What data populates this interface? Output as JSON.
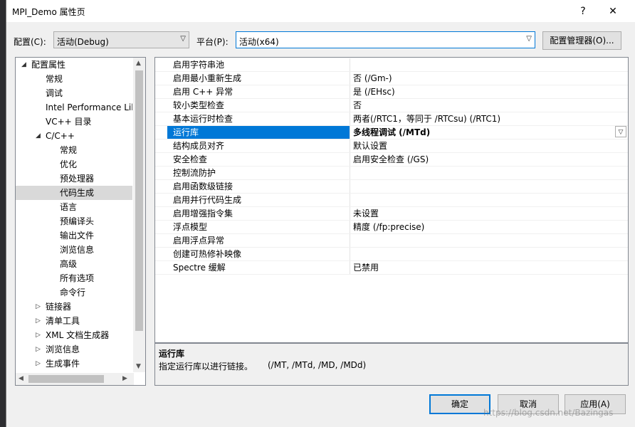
{
  "window": {
    "title": "MPI_Demo 属性页",
    "help_label": "?",
    "close_label": "✕"
  },
  "config": {
    "config_label": "配置(C):",
    "config_value": "活动(Debug)",
    "platform_label": "平台(P):",
    "platform_value": "活动(x64)",
    "manager_label": "配置管理器(O)..."
  },
  "tree": {
    "items": [
      {
        "label": "配置属性",
        "toggle": "◢"
      },
      {
        "label": "常规",
        "toggle": ""
      },
      {
        "label": "调试",
        "toggle": ""
      },
      {
        "label": "Intel Performance Libraries",
        "toggle": ""
      },
      {
        "label": "VC++ 目录",
        "toggle": ""
      },
      {
        "label": "C/C++",
        "toggle": "◢"
      },
      {
        "label": "常规",
        "toggle": ""
      },
      {
        "label": "优化",
        "toggle": ""
      },
      {
        "label": "预处理器",
        "toggle": ""
      },
      {
        "label": "代码生成",
        "toggle": ""
      },
      {
        "label": "语言",
        "toggle": ""
      },
      {
        "label": "预编译头",
        "toggle": ""
      },
      {
        "label": "输出文件",
        "toggle": ""
      },
      {
        "label": "浏览信息",
        "toggle": ""
      },
      {
        "label": "高级",
        "toggle": ""
      },
      {
        "label": "所有选项",
        "toggle": ""
      },
      {
        "label": "命令行",
        "toggle": ""
      },
      {
        "label": "链接器",
        "toggle": "▷"
      },
      {
        "label": "清单工具",
        "toggle": "▷"
      },
      {
        "label": "XML 文档生成器",
        "toggle": "▷"
      },
      {
        "label": "浏览信息",
        "toggle": "▷"
      },
      {
        "label": "生成事件",
        "toggle": "▷"
      }
    ]
  },
  "properties": {
    "rows": [
      {
        "name": "启用字符串池",
        "value": ""
      },
      {
        "name": "启用最小重新生成",
        "value": "否 (/Gm-)"
      },
      {
        "name": "启用 C++ 异常",
        "value": "是 (/EHsc)"
      },
      {
        "name": "较小类型检查",
        "value": "否"
      },
      {
        "name": "基本运行时检查",
        "value": "两者(/RTC1，等同于 /RTCsu) (/RTC1)"
      },
      {
        "name": "运行库",
        "value": "多线程调试 (/MTd)"
      },
      {
        "name": "结构成员对齐",
        "value": "默认设置"
      },
      {
        "name": "安全检查",
        "value": "启用安全检查 (/GS)"
      },
      {
        "name": "控制流防护",
        "value": ""
      },
      {
        "name": "启用函数级链接",
        "value": ""
      },
      {
        "name": "启用并行代码生成",
        "value": ""
      },
      {
        "name": "启用增强指令集",
        "value": "未设置"
      },
      {
        "name": "浮点模型",
        "value": "精度 (/fp:precise)"
      },
      {
        "name": "启用浮点异常",
        "value": ""
      },
      {
        "name": "创建可热修补映像",
        "value": ""
      },
      {
        "name": "Spectre 缓解",
        "value": "已禁用"
      }
    ]
  },
  "description": {
    "title": "运行库",
    "text": "指定运行库以进行链接。",
    "options": "(/MT, /MTd, /MD, /MDd)"
  },
  "buttons": {
    "ok": "确定",
    "cancel": "取消",
    "apply": "应用(A)"
  },
  "watermark": "https://blog.csdn.net/Bazingas"
}
